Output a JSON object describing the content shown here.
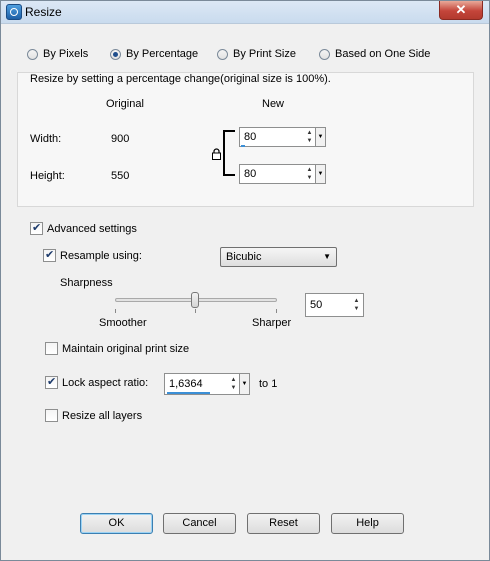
{
  "window": {
    "title": "Resize",
    "close_symbol": "✕"
  },
  "mode": {
    "options": [
      "By Pixels",
      "By Percentage",
      "By Print Size",
      "Based on One Side"
    ],
    "selected": "By Percentage"
  },
  "percent_group": {
    "caption": "Resize by setting a percentage change(original size is 100%).",
    "original_header": "Original",
    "new_header": "New",
    "width_label": "Width:",
    "height_label": "Height:",
    "original_width": "900",
    "original_height": "550",
    "new_width": "80",
    "new_height": "80"
  },
  "advanced": {
    "label": "Advanced settings",
    "checked": true,
    "resample_label": "Resample using:",
    "resample_checked": true,
    "resample_value": "Bicubic",
    "sharpness_label": "Sharpness",
    "smoother_label": "Smoother",
    "sharper_label": "Sharper",
    "sharpness_value": "50",
    "maintain_label": "Maintain original print size",
    "maintain_checked": false,
    "lock_label": "Lock aspect ratio:",
    "lock_checked": true,
    "ratio_value": "1,6364",
    "ratio_suffix": "to 1",
    "resize_layers_label": "Resize all layers",
    "resize_layers_checked": false
  },
  "buttons": {
    "ok": "OK",
    "cancel": "Cancel",
    "reset": "Reset",
    "help": "Help"
  },
  "colors": {
    "accent": "#3b8fd6",
    "close": "#c4453a"
  }
}
